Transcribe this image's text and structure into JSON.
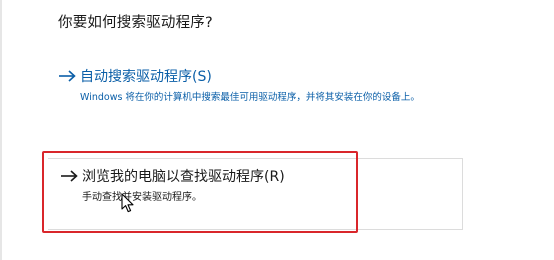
{
  "dialog": {
    "heading": "你要如何搜索驱动程序?"
  },
  "options": {
    "auto": {
      "title": "自动搜索驱动程序(S)",
      "description": "Windows 将在你的计算机中搜索最佳可用驱动程序，并将其安装在你的设备上。",
      "arrow_icon": "arrow-right-icon"
    },
    "browse": {
      "title": "浏览我的电脑以查找驱动程序(R)",
      "description": "手动查找并安装驱动程序。",
      "arrow_icon": "arrow-right-icon"
    }
  },
  "colors": {
    "link_blue": "#0b5fa8",
    "highlight_red": "#d9262b",
    "text_dark": "#1a1a1a"
  },
  "cursor": {
    "icon": "mouse-pointer-icon"
  }
}
